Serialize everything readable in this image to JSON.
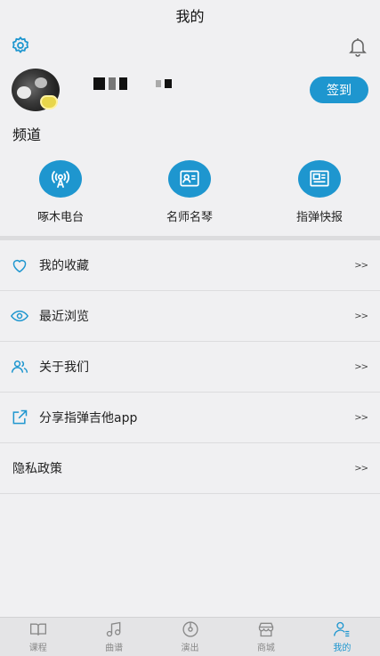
{
  "header": {
    "title": "我的"
  },
  "profile": {
    "checkin_label": "签到"
  },
  "channels": {
    "section_title": "频道",
    "items": [
      {
        "label": "啄木电台",
        "icon": "radio-tower-icon"
      },
      {
        "label": "名师名琴",
        "icon": "teacher-card-icon"
      },
      {
        "label": "指弹快报",
        "icon": "newspaper-icon"
      }
    ]
  },
  "menu": {
    "arrow": ">>",
    "items": [
      {
        "label": "我的收藏",
        "icon": "heart-icon"
      },
      {
        "label": "最近浏览",
        "icon": "eye-icon"
      },
      {
        "label": "关于我们",
        "icon": "users-icon"
      },
      {
        "label": "分享指弹吉他app",
        "icon": "share-icon"
      },
      {
        "label": "隐私政策",
        "icon": ""
      }
    ]
  },
  "tabbar": {
    "items": [
      {
        "label": "课程",
        "icon": "book-icon"
      },
      {
        "label": "曲谱",
        "icon": "music-note-icon"
      },
      {
        "label": "演出",
        "icon": "disc-icon"
      },
      {
        "label": "商城",
        "icon": "store-icon"
      },
      {
        "label": "我的",
        "icon": "profile-icon"
      }
    ],
    "active_index": 4
  },
  "colors": {
    "accent": "#1e96cf",
    "background": "#f0f0f2",
    "inactive": "#888888"
  }
}
